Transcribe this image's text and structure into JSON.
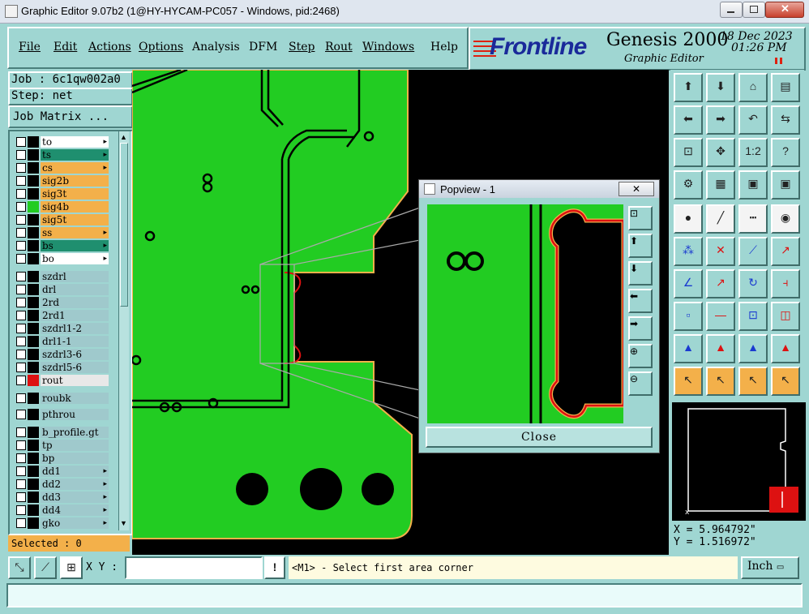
{
  "window": {
    "title": "Graphic Editor 9.07b2 (1@HY-HYCAM-PC057 - Windows, pid:2468)"
  },
  "menu": [
    "File",
    "Edit",
    "Actions",
    "Options",
    "Analysis",
    "DFM",
    "Step",
    "Rout",
    "Windows",
    "Help"
  ],
  "brand": {
    "logo": "Frontline",
    "product": "Genesis 2000",
    "subtitle": "Graphic Editor",
    "date": "18 Dec 2023",
    "time": "01:26 PM"
  },
  "job": {
    "job": "Job : 6c1qw002a0",
    "step": "Step: net",
    "matrix_button": "Job Matrix ..."
  },
  "layers": [
    {
      "name": "to",
      "color": "#ffffff",
      "swatch": "#000000",
      "arrow": true
    },
    {
      "name": "ts",
      "color": "#1f8f6f",
      "swatch": "#000000",
      "arrow": true
    },
    {
      "name": "cs",
      "color": "#f3b04a",
      "swatch": "#000000",
      "arrow": true
    },
    {
      "name": "sig2b",
      "color": "#f3b04a",
      "swatch": "#000000",
      "arrow": false
    },
    {
      "name": "sig3t",
      "color": "#f3b04a",
      "swatch": "#000000",
      "arrow": false
    },
    {
      "name": "sig4b",
      "color": "#f3b04a",
      "swatch": "#22cc22",
      "arrow": false
    },
    {
      "name": "sig5t",
      "color": "#f3b04a",
      "swatch": "#000000",
      "arrow": false
    },
    {
      "name": "ss",
      "color": "#f3b04a",
      "swatch": "#000000",
      "arrow": true
    },
    {
      "name": "bs",
      "color": "#1f8f6f",
      "swatch": "#000000",
      "arrow": true
    },
    {
      "name": "bo",
      "color": "#ffffff",
      "swatch": "#000000",
      "arrow": true
    },
    {
      "name": "szdrl",
      "color": "#9fc9cc",
      "swatch": "#000000",
      "arrow": false
    },
    {
      "name": "drl",
      "color": "#9fc9cc",
      "swatch": "#000000",
      "arrow": false
    },
    {
      "name": "2rd",
      "color": "#9fc9cc",
      "swatch": "#000000",
      "arrow": false
    },
    {
      "name": "2rd1",
      "color": "#9fc9cc",
      "swatch": "#000000",
      "arrow": false
    },
    {
      "name": "szdrl1-2",
      "color": "#9fc9cc",
      "swatch": "#000000",
      "arrow": false
    },
    {
      "name": "drl1-1",
      "color": "#9fc9cc",
      "swatch": "#000000",
      "arrow": false
    },
    {
      "name": "szdrl3-6",
      "color": "#9fc9cc",
      "swatch": "#000000",
      "arrow": false
    },
    {
      "name": "szdrl5-6",
      "color": "#9fc9cc",
      "swatch": "#000000",
      "arrow": false
    },
    {
      "name": "rout",
      "color": "#e8e8e8",
      "swatch": "#dd1111",
      "arrow": false
    },
    {
      "name": "roubk",
      "color": "#9fc9cc",
      "swatch": "#000000",
      "arrow": false
    },
    {
      "name": "pthrou",
      "color": "#9fc9cc",
      "swatch": "#000000",
      "arrow": false
    },
    {
      "name": "b_profile.gt",
      "color": "#9fc9cc",
      "swatch": "#000000",
      "arrow": false
    },
    {
      "name": "tp",
      "color": "#9fc9cc",
      "swatch": "#000000",
      "arrow": false
    },
    {
      "name": "bp",
      "color": "#9fc9cc",
      "swatch": "#000000",
      "arrow": false
    },
    {
      "name": "dd1",
      "color": "#9fc9cc",
      "swatch": "#000000",
      "arrow": true
    },
    {
      "name": "dd2",
      "color": "#9fc9cc",
      "swatch": "#000000",
      "arrow": true
    },
    {
      "name": "dd3",
      "color": "#9fc9cc",
      "swatch": "#000000",
      "arrow": true
    },
    {
      "name": "dd4",
      "color": "#9fc9cc",
      "swatch": "#000000",
      "arrow": true
    },
    {
      "name": "gko",
      "color": "#9fc9cc",
      "swatch": "#000000",
      "arrow": true
    }
  ],
  "selected": "Selected : 0",
  "coords": {
    "x": "X = 5.964792\"",
    "y": "Y = 1.516972\""
  },
  "bottom": {
    "xy_label": "X Y :",
    "xy_value": "",
    "bang": "!",
    "prompt": "<M1> - Select first area corner",
    "units": "Inch"
  },
  "popview": {
    "title": "Popview - 1",
    "close_label": "Close"
  },
  "colors": {
    "panel": "#9fd6d2",
    "board": "#22cc22",
    "highlight": "#f3b04a",
    "accent": "#dd1111"
  }
}
